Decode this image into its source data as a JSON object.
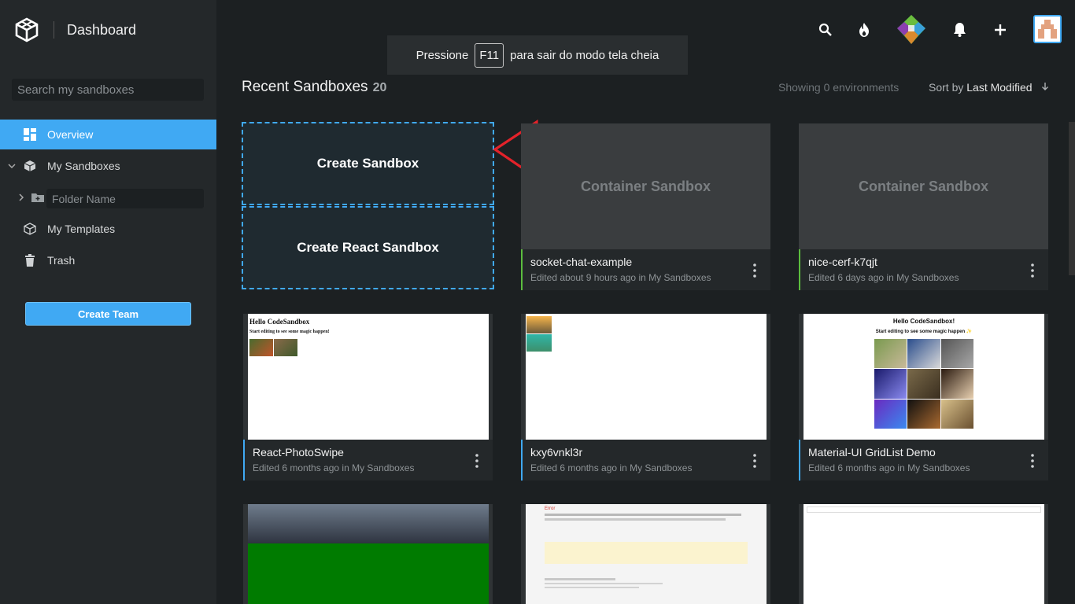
{
  "header": {
    "title": "Dashboard"
  },
  "sidebar": {
    "search_placeholder": "Search my sandboxes",
    "items": [
      {
        "label": "Overview",
        "icon": "overview-icon",
        "active": true
      },
      {
        "label": "My Sandboxes",
        "icon": "cube-icon"
      },
      {
        "label": "My Templates",
        "icon": "template-icon"
      },
      {
        "label": "Trash",
        "icon": "trash-icon"
      }
    ],
    "folder_placeholder": "Folder Name",
    "create_team_label": "Create Team"
  },
  "toast": {
    "before": "Pressione",
    "key": "F11",
    "after": "para sair do modo tela cheia"
  },
  "section": {
    "title": "Recent Sandboxes",
    "count": "20",
    "showing": "Showing 0 environments",
    "sort_prefix": "Sort by",
    "sort_value": "Last Modified"
  },
  "create_cards": {
    "sandbox": "Create Sandbox",
    "react": "Create React Sandbox"
  },
  "cards": [
    {
      "name": "socket-chat-example",
      "meta": "Edited about 9 hours ago in My Sandboxes",
      "thumb_label": "Container Sandbox"
    },
    {
      "name": "nice-cerf-k7qjt",
      "meta": "Edited 6 days ago in My Sandboxes",
      "thumb_label": "Container Sandbox"
    },
    {
      "name": "React-PhotoSwipe",
      "meta": "Edited 6 months ago in My Sandboxes",
      "thumb_title": "Hello CodeSandbox",
      "thumb_sub": "Start editing to see some magic happen!"
    },
    {
      "name": "kxy6vnkl3r",
      "meta": "Edited 6 months ago in My Sandboxes"
    },
    {
      "name": "Material-UI GridList Demo",
      "meta": "Edited 6 months ago in My Sandboxes",
      "thumb_title": "Hello CodeSandbox!",
      "thumb_sub": "Start editing to see some magic happen ✨"
    }
  ],
  "preview_error": {
    "title": "Error"
  },
  "colors": {
    "accent": "#40a9f3",
    "green_accent": "#5cbd3e",
    "sidebar_bg": "#24282a",
    "page_bg": "#1c2022"
  }
}
